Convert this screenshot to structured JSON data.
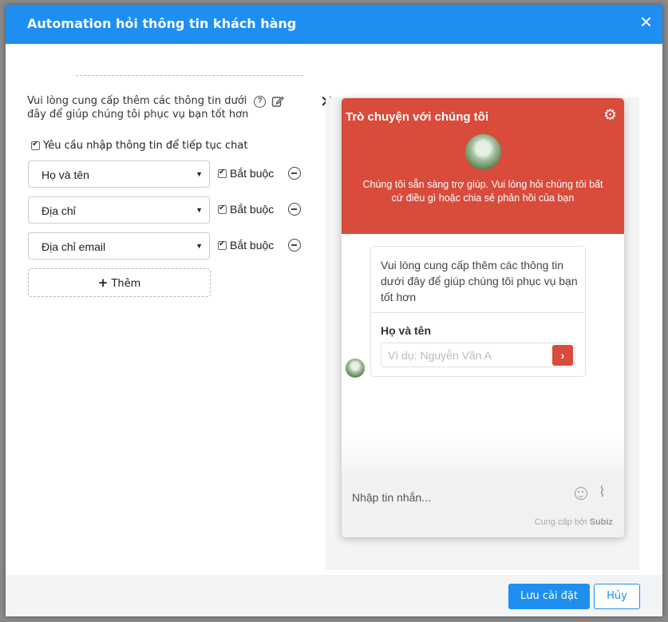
{
  "header": {
    "title": "Automation hỏi thông tin khách hàng",
    "close_icon": "×"
  },
  "form": {
    "intro": "Vui lòng cung cấp thêm các thông tin dưới đây để giúp chúng tôi phục vụ bạn tốt hơn",
    "require_label": "Yêu cầu nhập thông tin để tiếp tục chat",
    "require_checked": true,
    "fields": [
      {
        "value": "Họ và tên",
        "required_label": "Bắt buộc",
        "required": true
      },
      {
        "value": "Địa chỉ",
        "required_label": "Bắt buộc",
        "required": true
      },
      {
        "value": "Địa chỉ email",
        "required_label": "Bắt buộc",
        "required": true
      }
    ],
    "add_label": "Thêm",
    "add_icon": "+",
    "close_icon": "✕"
  },
  "widget": {
    "title": "Trò chuyện với chúng tôi",
    "subtitle": "Chúng tôi sẵn sàng trợ giúp. Vui lòng hỏi chúng tôi bất cứ điều gì hoặc chia sẻ phản hồi của bạn",
    "message": "Vui lòng cung cấp thêm các thông tin dưới đây để giúp chúng tôi phục vụ bạn tốt hơn",
    "field_label": "Họ và tên",
    "field_placeholder": "Ví dụ: Nguyễn Văn A",
    "send_icon": "›",
    "input_placeholder": "Nhập tin nhắn...",
    "powered_prefix": "Cung cấp bởi",
    "powered_brand": "Subiz",
    "gear_icon": "⚙",
    "clip_icon": "📎",
    "accent_color": "#d94b3b"
  },
  "footer": {
    "save_label": "Lưu cài đặt",
    "cancel_label": "Hủy"
  },
  "colors": {
    "primary": "#1e8ff0"
  }
}
